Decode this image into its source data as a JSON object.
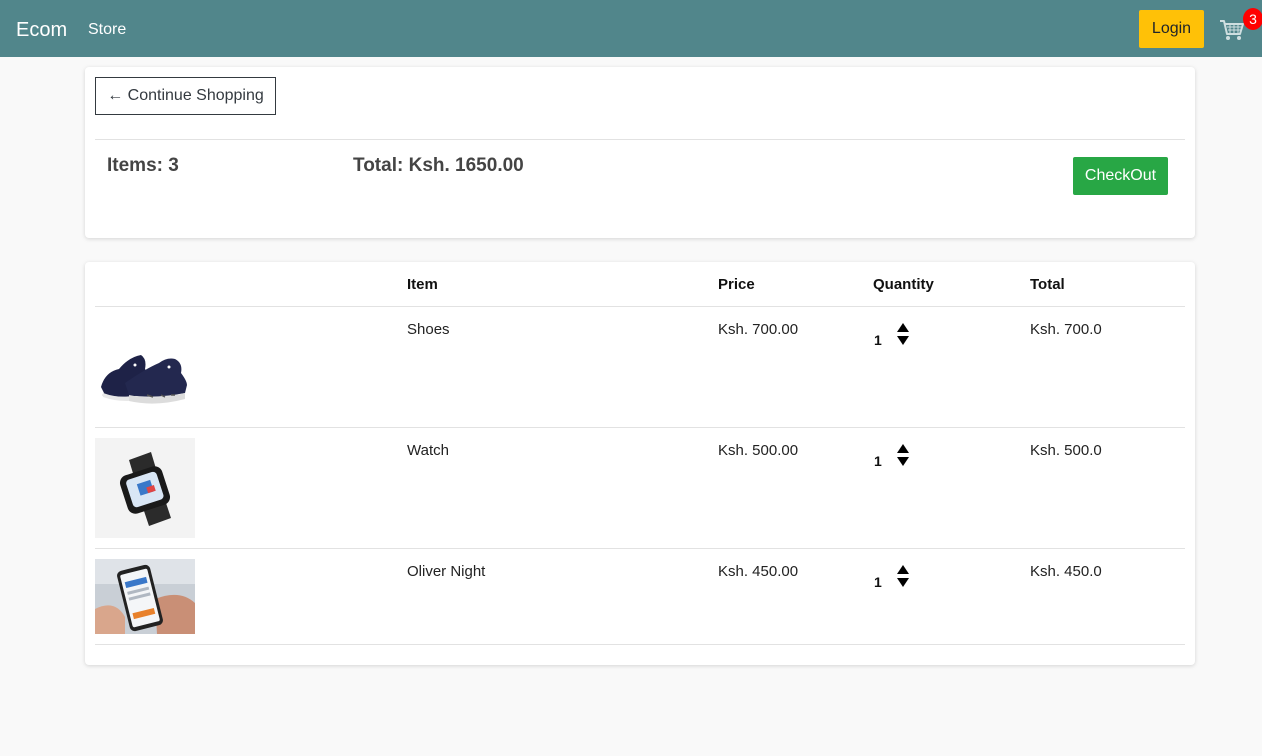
{
  "navbar": {
    "brand": "Ecom",
    "store_link": "Store",
    "login_label": "Login",
    "cart_count": "3",
    "cart_icon": "cart-icon"
  },
  "summary": {
    "continue_label": "← Continue Shopping",
    "items_label": "Items:",
    "items_value": "3",
    "total_label": "Total:",
    "total_value": "Ksh. 1650.00",
    "checkout_label": "CheckOut"
  },
  "table": {
    "headers": [
      "",
      "Item",
      "Price",
      "Quantity",
      "Total"
    ],
    "rows": [
      {
        "item": "Shoes",
        "price": "Ksh. 700.00",
        "quantity": "1",
        "total": "Ksh. 700.0",
        "image": "shoes-image"
      },
      {
        "item": "Watch",
        "price": "Ksh. 500.00",
        "quantity": "1",
        "total": "Ksh. 500.0",
        "image": "watch-image"
      },
      {
        "item": "Oliver Night",
        "price": "Ksh. 450.00",
        "quantity": "1",
        "total": "Ksh. 450.0",
        "image": "phone-image"
      }
    ]
  },
  "colors": {
    "navbar_bg": "#51868b",
    "login_bg": "#ffc107",
    "checkout_bg": "#28a745",
    "badge_bg": "#ff0000",
    "page_bg": "#f9f9f9"
  }
}
